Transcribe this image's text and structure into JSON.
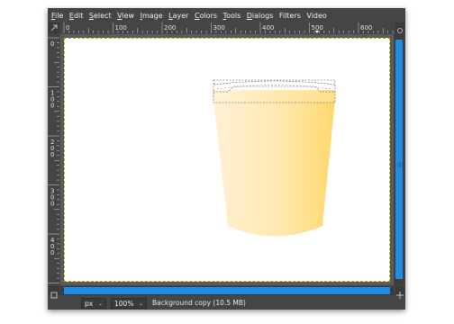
{
  "menu": [
    {
      "mnemonic": "F",
      "rest": "ile"
    },
    {
      "mnemonic": "E",
      "rest": "dit"
    },
    {
      "mnemonic": "S",
      "rest": "elect"
    },
    {
      "mnemonic": "V",
      "rest": "iew"
    },
    {
      "mnemonic": "I",
      "rest": "mage"
    },
    {
      "mnemonic": "L",
      "rest": "ayer"
    },
    {
      "mnemonic": "C",
      "rest": "olors"
    },
    {
      "mnemonic": "T",
      "rest": "ools"
    },
    {
      "mnemonic": "D",
      "rest": "ialogs"
    },
    {
      "mnemonic": "",
      "rest": "Filters"
    },
    {
      "mnemonic": "",
      "rest": "Video"
    }
  ],
  "ruler": {
    "h_labels": [
      "0",
      "100",
      "200",
      "300",
      "400",
      "500",
      "600"
    ],
    "v_labels": [
      "0",
      "100",
      "200",
      "300",
      "400"
    ]
  },
  "status": {
    "unit": "px",
    "zoom": "100%",
    "layer_info": "Background copy (10.5 MB)"
  },
  "colors": {
    "accent": "#1e8de6",
    "cup_light": "#fff0d4",
    "cup_dark": "#ffd76b"
  }
}
